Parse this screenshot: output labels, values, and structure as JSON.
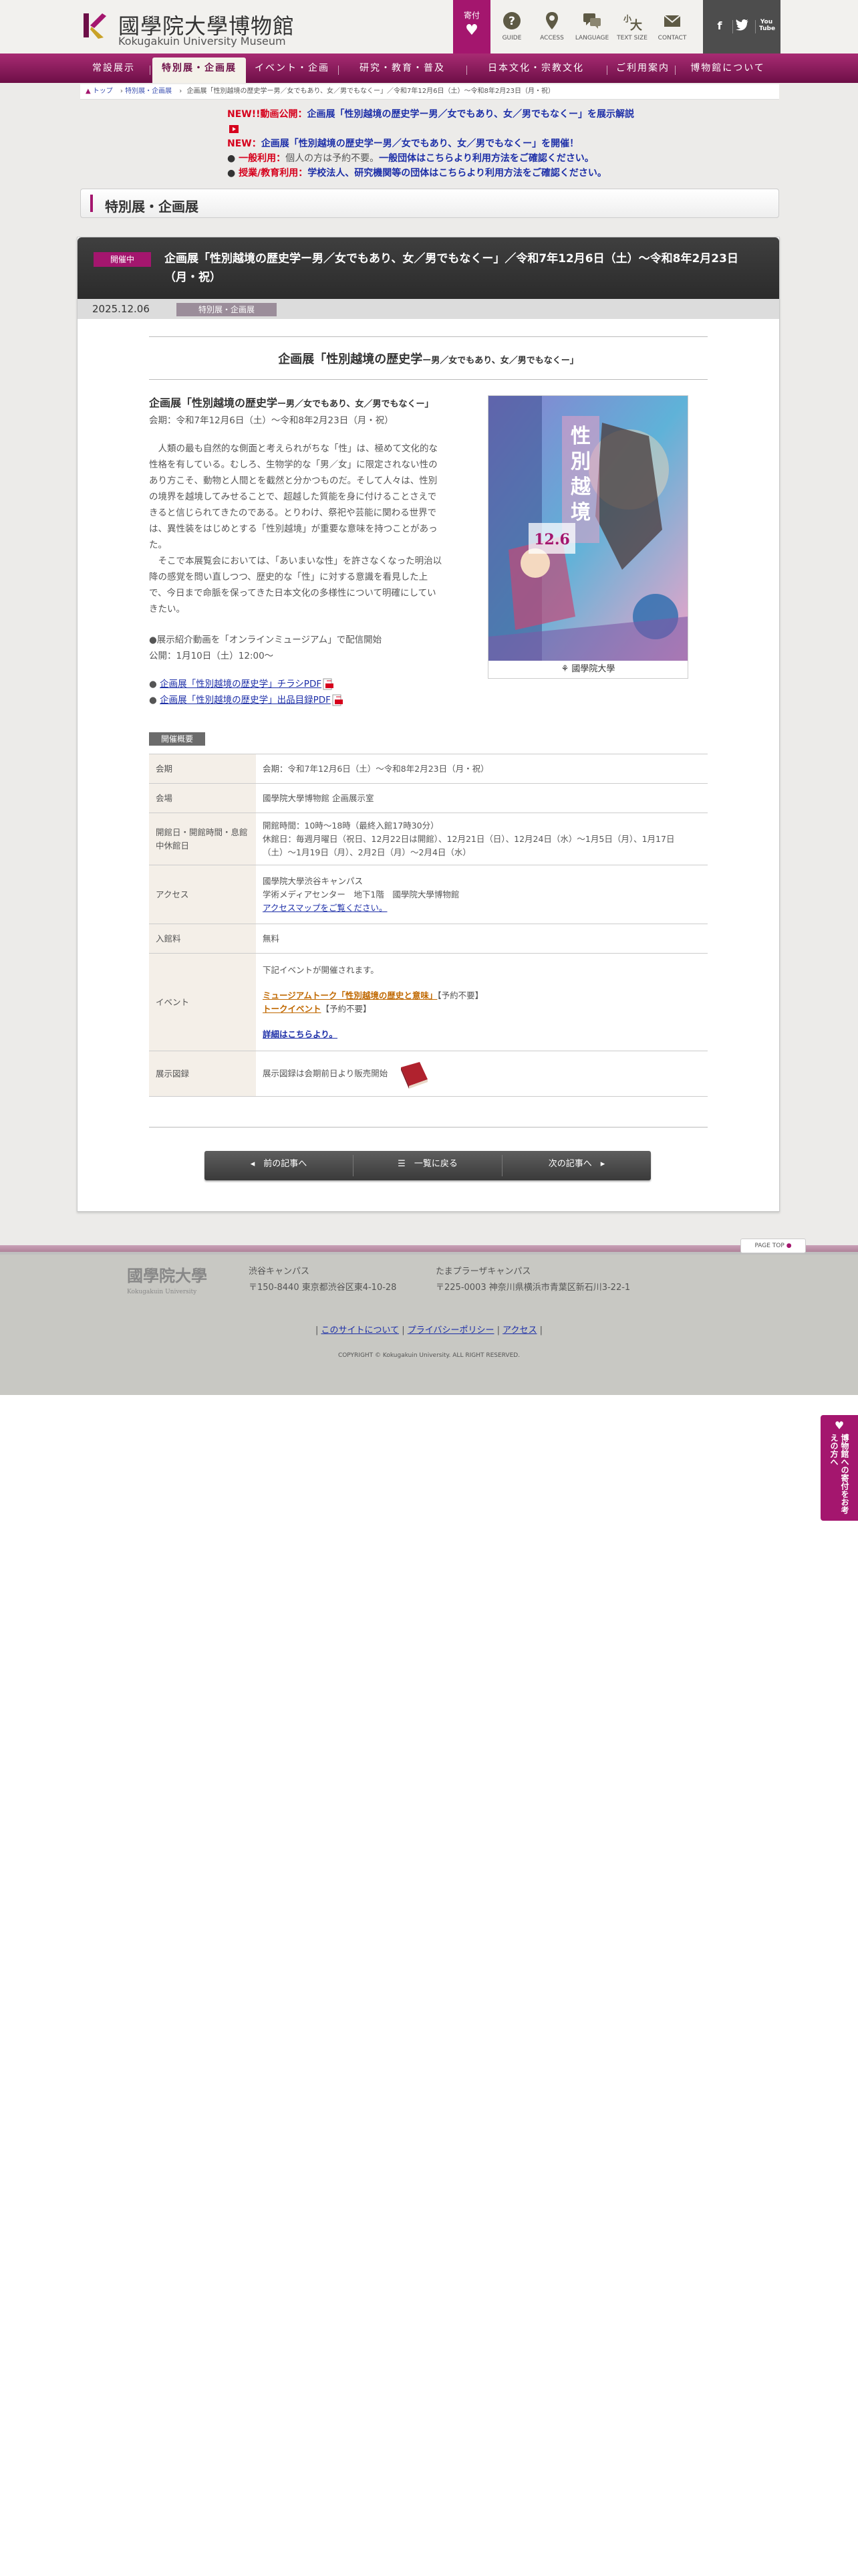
{
  "header": {
    "logo_ja": "國學院大學博物館",
    "logo_en": "Kokugakuin University Museum",
    "donate_label": "寄付",
    "icons": [
      {
        "label": "GUIDE",
        "icon": "question-icon"
      },
      {
        "label": "ACCESS",
        "icon": "pin-icon"
      },
      {
        "label": "LANGUAGE",
        "icon": "speech-icon"
      },
      {
        "label": "TEXT SIZE",
        "icon": "text-size-icon"
      },
      {
        "label": "CONTACT",
        "icon": "mail-icon"
      }
    ],
    "sns": [
      "f",
      "t",
      "You Tube"
    ]
  },
  "nav": [
    "常設展示",
    "特別展・企画展",
    "イベント・企画",
    "研究・教育・普及",
    "日本文化・宗教文化",
    "ご利用案内",
    "博物館について"
  ],
  "breadcrumb": {
    "home": "トップ",
    "category": "特別展・企画展",
    "current": "企画展「性別越境の歴史学ー男／女でもあり、女／男でもなくー」／令和7年12月6日（土）〜令和8年2月23日（月・祝）"
  },
  "news": [
    {
      "tag": "NEW!!動画公開：",
      "text": "企画展「性別越境の歴史学ー男／女でもあり、女／男でもなくー」を展示解説"
    },
    {
      "tag": "NEW：",
      "text": "企画展「性別越境の歴史学ー男／女でもあり、女／男でもなくー」を開催！"
    },
    {
      "tag": "一般利用：",
      "text_gray": "個人の方は予約不要。",
      "text": "一般団体はこちらより利用方法をご確認ください。"
    },
    {
      "tag": "授業/教育利用：",
      "text": "学校法人、研究機関等の団体はこちらより利用方法をご確認ください。"
    }
  ],
  "section_title": "特別展・企画展",
  "article": {
    "status": "開催中",
    "title": "企画展「性別越境の歴史学ー男／女でもあり、女／男でもなくー」／令和7年12月6日（土）〜令和8年2月23日（月・祝）",
    "date": "2025.12.06",
    "category": "特別展・企画展",
    "subtitle_main": "企画展「性別越境の歴史学",
    "subtitle_sub": "ー男／女でもあり、女／男でもなくー」",
    "lead_heading_main": "企画展「性別越境の歴史学",
    "lead_heading_sub": "ー男／女でもあり、女／男でもなくー」",
    "lead_period": "会期：令和7年12月6日（土）〜令和8年2月23日（月・祝）",
    "lead_p1": "　人類の最も自然的な側面と考えられがちな「性」は、極めて文化的な性格を有している。むしろ、生物学的な「男／女」に限定されない性のあり方こそ、動物と人間とを截然と分かつものだ。そして人々は、性別の境界を越境してみせることで、超越した質能を身に付けることさえできると信じられてきたのである。とりわけ、祭祀や芸能に関わる世界では、異性装をはじめとする「性別越境」が重要な意味を持つことがあった。",
    "lead_p2": "　そこで本展覧会においては、「あいまいな性」を許さなくなった明治以降の感覚を問い直しつつ、歴史的な「性」に対する意識を看見した上で、今日まで命脈を保ってきた日本文化の多様性について明確にしていきたい。",
    "lead_video1": "●展示紹介動画を「オンラインミュージアム」で配信開始",
    "lead_video2": "公開：1月10日（土）12:00〜",
    "pdf_links": [
      "企画展「性別越境の歴史学」チラシPDF",
      "企画展「性別越境の歴史学」出品目録PDF"
    ],
    "poster_caption": "國學院大學",
    "gaiyo_label": "開催概要",
    "info": [
      {
        "key": "会期",
        "value": "会期：令和7年12月6日（土）〜令和8年2月23日（月・祝）"
      },
      {
        "key": "会場",
        "value": "國學院大學博物館 企画展示室"
      },
      {
        "key": "開館日・開館時間・息館中休館日",
        "value": "開館時間：10時〜18時（最終入館17時30分）",
        "value2": "休館日：毎週月曜日（祝日、12月22日は開館）、12月21日（日）、12月24日（水）〜1月5日（月）、1月17日（土）〜1月19日（月）、2月2日（月）〜2月4日（水）"
      },
      {
        "key": "アクセス",
        "value": "國學院大學渋谷キャンパス",
        "value2": "学術メディアセンター　地下1階　國學院大學博物館",
        "link": "アクセスマップをご覧ください。"
      },
      {
        "key": "入館料",
        "value": "無料"
      },
      {
        "key": "イベント",
        "value": "下記イベントが開催されます。",
        "ev1_link": "ミュージアムトーク「性別越境の歴史と意味」",
        "ev1_note": "【予約不要】",
        "ev2_link": "トークイベント",
        "ev2_note": "【予約不要】",
        "more": "詳細はこちらより。"
      },
      {
        "key": "展示図録",
        "value": "展示図録は会期前日より販売開始"
      }
    ],
    "pager": {
      "prev": "前の記事へ",
      "list": "一覧に戻る",
      "next": "次の記事へ"
    }
  },
  "footer": {
    "pagetop": "PAGE TOP",
    "logo_ja": "國學院大學",
    "logo_en": "Kokugakuin University",
    "campus1_name": "渋谷キャンパス",
    "campus1_addr": "〒150-8440 東京都渋谷区東4-10-28",
    "campus2_name": "たまプラーザキャンパス",
    "campus2_addr": "〒225-0003 神奈川県横浜市青葉区新石川3-22-1",
    "links": [
      "このサイトについて",
      "プライバシーポリシー",
      "アクセス"
    ],
    "copyright": "COPYRIGHT © Kokugakuin University. ALL RIGHT RESERVED."
  },
  "side_tab": "博物館への寄付をお考えの方へ",
  "colors": {
    "brand": "#a4166e",
    "nav": "#6d0f47",
    "link": "#1d2fa8",
    "alert": "#d6001c"
  }
}
